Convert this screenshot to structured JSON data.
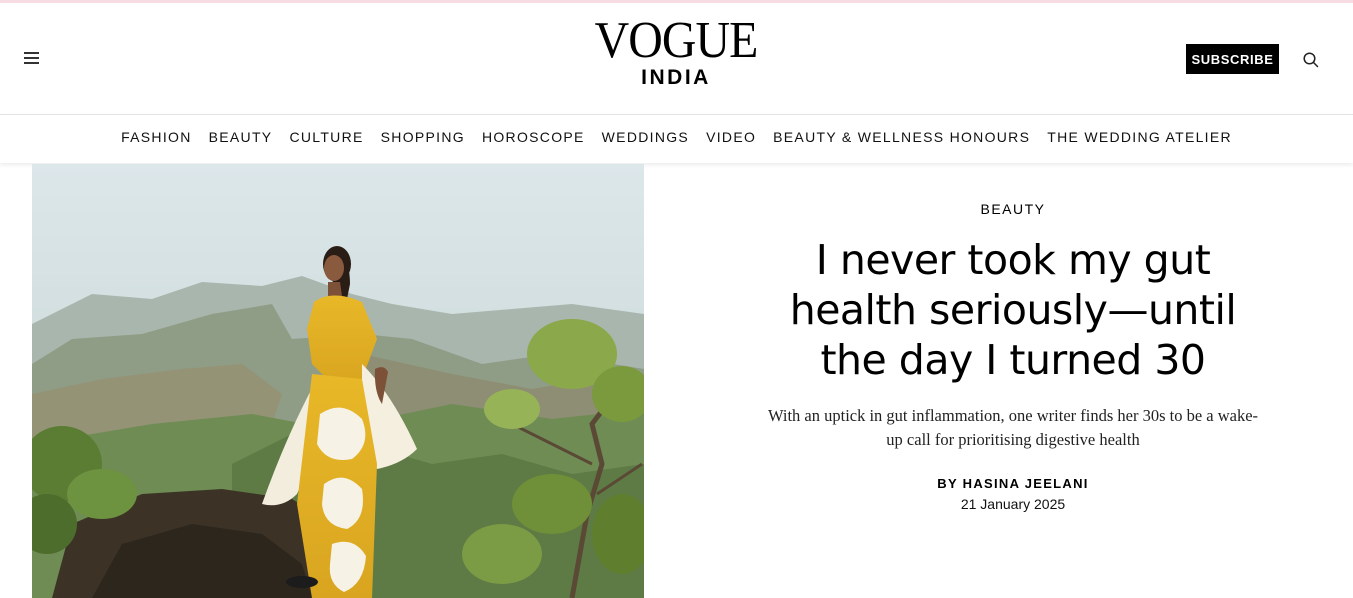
{
  "header": {
    "logo_main": "VOGUE",
    "logo_sub": "INDIA",
    "subscribe_label": "SUBSCRIBE"
  },
  "nav": {
    "items": [
      "FASHION",
      "BEAUTY",
      "CULTURE",
      "SHOPPING",
      "HOROSCOPE",
      "WEDDINGS",
      "VIDEO",
      "BEAUTY & WELLNESS HONOURS",
      "THE WEDDING ATELIER"
    ]
  },
  "story": {
    "rubric": "BEAUTY",
    "headline": "I never took my gut health seriously—until the day I turned 30",
    "dek": "With an uptick in gut inflammation, one writer finds her 30s to be a wake-up call for prioritising digestive health",
    "byline": "BY HASINA JEELANI",
    "date": "21 January 2025"
  },
  "colors": {
    "top_accent": "#f7dde3",
    "subscribe_bg": "#000000",
    "dress_yellow": "#e6b52a"
  },
  "icons": {
    "menu": "hamburger-icon",
    "search": "search-icon"
  }
}
